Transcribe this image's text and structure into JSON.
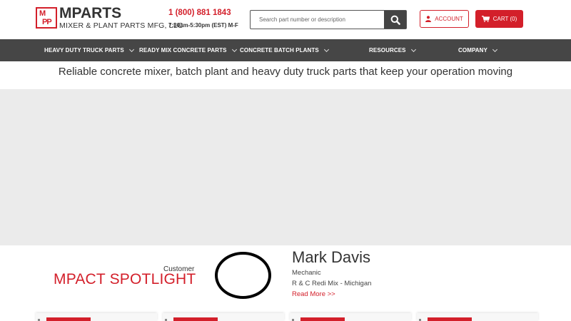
{
  "header": {
    "logo_top": "MPARTS",
    "logo_box_top": "M",
    "logo_box_bottom": "PP",
    "logo_sub": "MIXER & PLANT PARTS MFG, LLC",
    "phone": "1 (800) 881 1843",
    "hours": "7:30am-5:30pm (EST) M-F",
    "search_placeholder": "Search part number or description",
    "account_label": "ACCOUNT",
    "cart_label": "CART (0)"
  },
  "nav": {
    "items": [
      {
        "label": "HEAVY DUTY TRUCK PARTS"
      },
      {
        "label": "READY MIX CONCRETE PARTS"
      },
      {
        "label": "CONCRETE BATCH PLANTS"
      },
      {
        "label": "RESOURCES"
      },
      {
        "label": "COMPANY"
      }
    ]
  },
  "tagline": "Reliable concrete mixer, batch plant and heavy duty truck parts that keep your operation moving",
  "spotlight": {
    "customer_label": "Customer",
    "title": "MPACT SPOTLIGHT",
    "name": "Mark Davis",
    "role": "Mechanic",
    "company": "R & C Redi Mix - Michigan",
    "read_more": "Read More >>"
  },
  "colors": {
    "brand_red": "#d31f2a",
    "nav_bg": "#464646",
    "hero_bg": "#ebebeb"
  },
  "icons": {
    "search": "search-icon",
    "account": "user-icon",
    "cart": "cart-icon",
    "chevron": "chevron-down-icon"
  }
}
